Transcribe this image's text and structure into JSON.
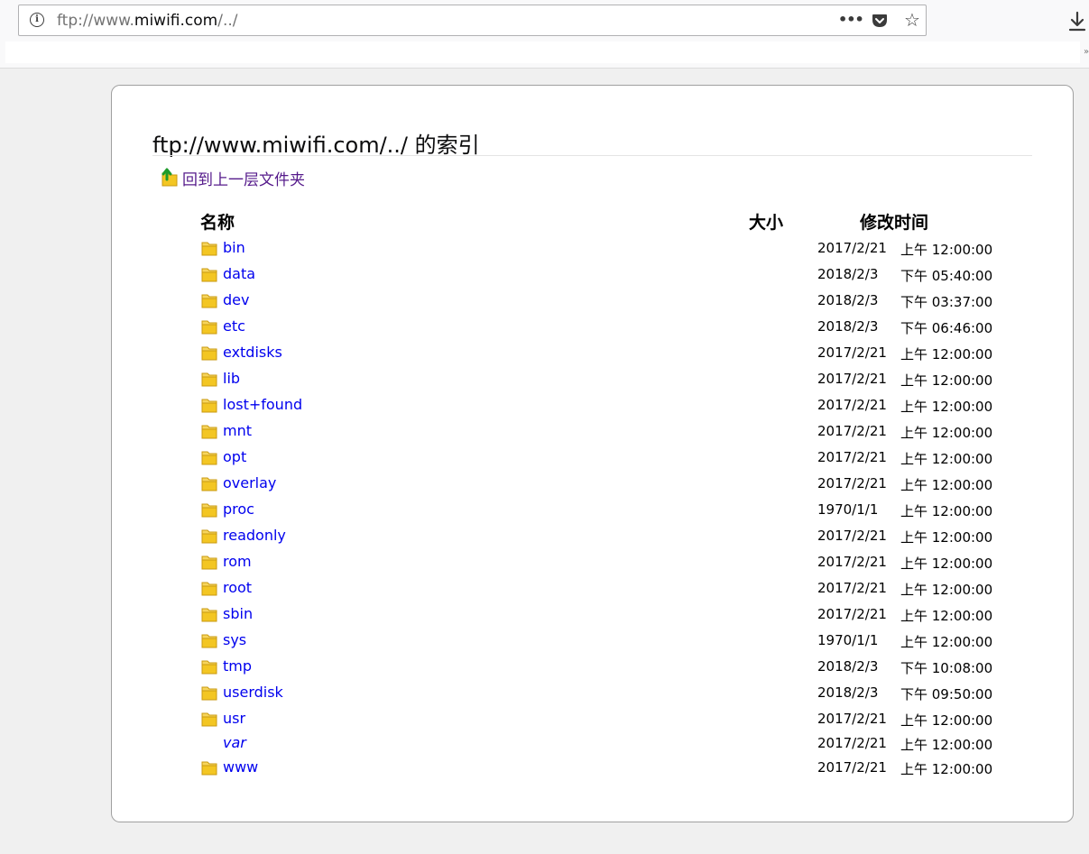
{
  "browser": {
    "url_prefix": "ftp://www.",
    "url_host": "miwifi.com",
    "url_suffix": "/../",
    "icons": {
      "info": "info-icon",
      "page_actions": "page-actions-icon",
      "pocket": "pocket-icon",
      "bookmark": "star-icon",
      "downloads": "download-icon"
    }
  },
  "listing": {
    "title": "ftp://www.miwifi.com/../ 的索引",
    "parent_link_label": "回到上一层文件夹",
    "columns": {
      "name": "名称",
      "size": "大小",
      "modified": "修改时间"
    },
    "entries": [
      {
        "name": "bin",
        "icon": "folder-icon",
        "date": "2017/2/21",
        "time": "上午 12:00:00"
      },
      {
        "name": "data",
        "icon": "folder-icon",
        "date": "2018/2/3",
        "time": "下午 05:40:00"
      },
      {
        "name": "dev",
        "icon": "folder-icon",
        "date": "2018/2/3",
        "time": "下午 03:37:00"
      },
      {
        "name": "etc",
        "icon": "folder-icon",
        "date": "2018/2/3",
        "time": "下午 06:46:00"
      },
      {
        "name": "extdisks",
        "icon": "folder-icon",
        "date": "2017/2/21",
        "time": "上午 12:00:00"
      },
      {
        "name": "lib",
        "icon": "folder-icon",
        "date": "2017/2/21",
        "time": "上午 12:00:00"
      },
      {
        "name": "lost+found",
        "icon": "folder-icon",
        "date": "2017/2/21",
        "time": "上午 12:00:00"
      },
      {
        "name": "mnt",
        "icon": "folder-icon",
        "date": "2017/2/21",
        "time": "上午 12:00:00"
      },
      {
        "name": "opt",
        "icon": "folder-icon",
        "date": "2017/2/21",
        "time": "上午 12:00:00"
      },
      {
        "name": "overlay",
        "icon": "folder-icon",
        "date": "2017/2/21",
        "time": "上午 12:00:00"
      },
      {
        "name": "proc",
        "icon": "folder-icon",
        "date": "1970/1/1",
        "time": "上午 12:00:00"
      },
      {
        "name": "readonly",
        "icon": "folder-icon",
        "date": "2017/2/21",
        "time": "上午 12:00:00"
      },
      {
        "name": "rom",
        "icon": "folder-icon",
        "date": "2017/2/21",
        "time": "上午 12:00:00"
      },
      {
        "name": "root",
        "icon": "folder-icon",
        "date": "2017/2/21",
        "time": "上午 12:00:00"
      },
      {
        "name": "sbin",
        "icon": "folder-icon",
        "date": "2017/2/21",
        "time": "上午 12:00:00"
      },
      {
        "name": "sys",
        "icon": "folder-icon",
        "date": "1970/1/1",
        "time": "上午 12:00:00"
      },
      {
        "name": "tmp",
        "icon": "folder-icon",
        "date": "2018/2/3",
        "time": "下午 10:08:00"
      },
      {
        "name": "userdisk",
        "icon": "folder-icon",
        "date": "2018/2/3",
        "time": "下午 09:50:00"
      },
      {
        "name": "usr",
        "icon": "folder-icon",
        "date": "2017/2/21",
        "time": "上午 12:00:00"
      },
      {
        "name": "var",
        "icon": "",
        "italic": true,
        "date": "2017/2/21",
        "time": "上午 12:00:00"
      },
      {
        "name": "www",
        "icon": "folder-icon",
        "date": "2017/2/21",
        "time": "上午 12:00:00"
      }
    ]
  },
  "colors": {
    "link": "#0000ee",
    "visited_link": "#551a8b",
    "page_bg": "#f0f0f0",
    "panel_bg": "#ffffff",
    "folder": "#f3c623"
  }
}
